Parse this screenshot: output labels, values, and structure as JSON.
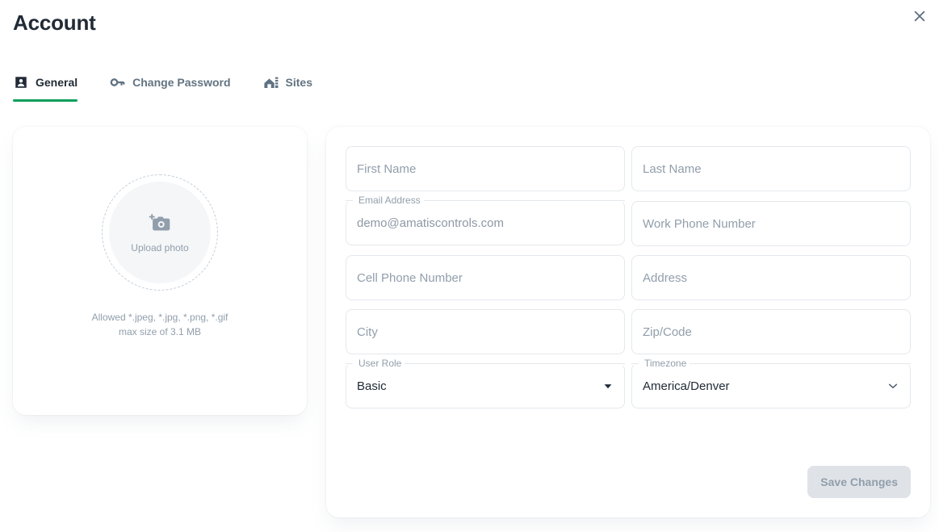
{
  "header": {
    "title": "Account",
    "close_icon": "close-icon"
  },
  "tabs": [
    {
      "label": "General",
      "icon": "account-box-icon",
      "active": true
    },
    {
      "label": "Change Password",
      "icon": "key-icon",
      "active": false
    },
    {
      "label": "Sites",
      "icon": "building-icon",
      "active": false
    }
  ],
  "photo_card": {
    "upload_icon": "camera-plus-icon",
    "upload_label": "Upload photo",
    "help_line_1": "Allowed *.jpeg, *.jpg, *.png, *.gif",
    "help_line_2": "max size of 3.1 MB"
  },
  "form": {
    "fields": [
      {
        "name": "first-name",
        "placeholder": "First Name"
      },
      {
        "name": "last-name",
        "placeholder": "Last Name"
      },
      {
        "name": "email",
        "label": "Email Address",
        "value": "demo@amatiscontrols.com"
      },
      {
        "name": "work-phone",
        "placeholder": "Work Phone Number"
      },
      {
        "name": "cell-phone",
        "placeholder": "Cell Phone Number"
      },
      {
        "name": "address",
        "placeholder": "Address"
      },
      {
        "name": "city",
        "placeholder": "City"
      },
      {
        "name": "zip",
        "placeholder": "Zip/Code"
      },
      {
        "name": "user-role",
        "label": "User Role",
        "value": "Basic",
        "icon": "triangle-down-icon"
      },
      {
        "name": "timezone",
        "label": "Timezone",
        "value": "America/Denver",
        "icon": "chevron-down-icon"
      }
    ],
    "save_label": "Save Changes"
  },
  "colors": {
    "accent_green": "#0aa05a",
    "title": "#212b36",
    "muted": "#919eab",
    "border": "#e4e8ec",
    "disabled_bg": "#dfe3e8"
  }
}
